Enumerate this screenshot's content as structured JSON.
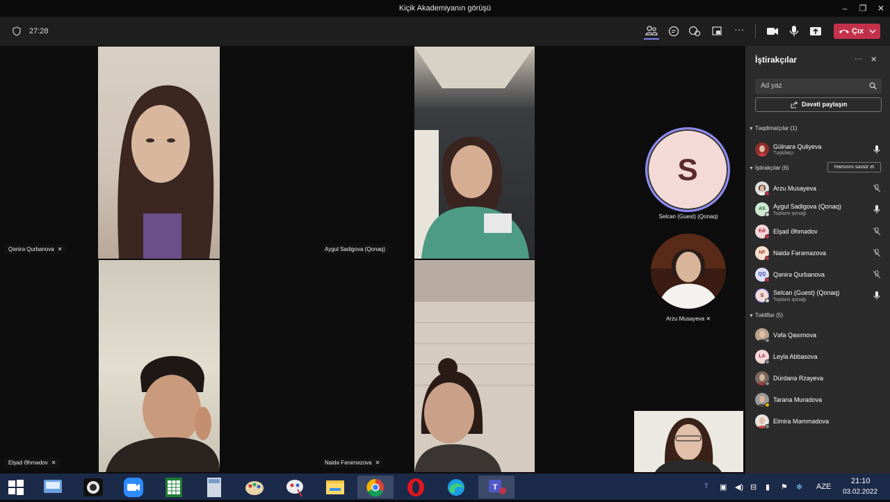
{
  "window": {
    "title": "Kiçik Akademiyanın görüşü",
    "minimize": "–",
    "restore": "❐",
    "close": "✕"
  },
  "meeting": {
    "timer": "27:28",
    "leave_label": "Çıx"
  },
  "colors": {
    "accent": "#7f85f5",
    "leave": "#c4314b",
    "panel_bg": "#2b2b2b",
    "toolbar_bg": "#1f1f1f",
    "taskbar_bg": "#1c2a4a"
  },
  "toolbar_icons": [
    "people-icon",
    "chat-icon",
    "reactions-icon",
    "share-tray-icon",
    "more-icon",
    "camera-icon",
    "microphone-icon",
    "share-screen-icon",
    "hang-up-icon"
  ],
  "video_tiles": [
    {
      "name": "Qənirə Qurbanova",
      "muted": true
    },
    {
      "name": "Aygul Sadigova (Qonaq)",
      "muted": false
    },
    {
      "name": "Elşad Əhmədov",
      "muted": true
    },
    {
      "name": "Naidə Fərəməzova",
      "muted": true
    }
  ],
  "side_tiles": {
    "selcan_initial": "S",
    "selcan_caption": "Selcan (Guest) (Qonaq)",
    "arzu_caption": "Arzu Musayeva"
  },
  "panel": {
    "title": "İştirakçılar",
    "more": "···",
    "close": "✕",
    "search_placeholder": "Ad yaz",
    "share_invite": "Dəvəti paylaşın",
    "mute_all": "Hamısını səssiz et",
    "sections": {
      "presenters": "Təqdimatçılar (1)",
      "attendees": "İştirakçılar (6)",
      "suggestions": "Təkliflər (5)"
    },
    "presenters": [
      {
        "name": "Gülnarə Quliyeva",
        "sub": "Təşkilatçı",
        "avatar": "photo",
        "mic": "on"
      }
    ],
    "attendees": [
      {
        "name": "Arzu Musayeva",
        "sub": "",
        "avatar": "photo",
        "mic": "off"
      },
      {
        "name": "Aygul Sadigova (Qonaq)",
        "sub": "Toplantı qonağı",
        "initials": "AS",
        "mic": "on"
      },
      {
        "name": "Elşad Əhmədov",
        "sub": "",
        "initials": "EƏ",
        "mic": "off"
      },
      {
        "name": "Naidə Fərəməzova",
        "sub": "",
        "initials": "NF",
        "mic": "off"
      },
      {
        "name": "Qənirə Qurbanova",
        "sub": "",
        "initials": "QQ",
        "mic": "off"
      },
      {
        "name": "Selcan (Guest) (Qonaq)",
        "sub": "Toplantı qonağı",
        "initials": "S",
        "mic": "on"
      }
    ],
    "suggestions": [
      {
        "name": "Vəfa Qasımova",
        "avatar": "photo"
      },
      {
        "name": "Leyla Abbasova",
        "initials": "LA"
      },
      {
        "name": "Dürdanə Rzayeva",
        "avatar": "photo"
      },
      {
        "name": "Tarana Muradova",
        "avatar": "photo"
      },
      {
        "name": "Elmira Məmmədova",
        "avatar": "photo"
      }
    ]
  },
  "taskbar": {
    "apps": [
      "start-icon",
      "keyboard-app-icon",
      "camera-app-icon",
      "zoom-icon",
      "calculator-icon",
      "calc-app-icon",
      "paint-icon",
      "paint2-icon",
      "file-explorer-icon",
      "chrome-icon",
      "opera-icon",
      "edge-icon",
      "teams-icon"
    ],
    "lang": "AZE",
    "time": "21:10",
    "date": "03.02.2022"
  }
}
